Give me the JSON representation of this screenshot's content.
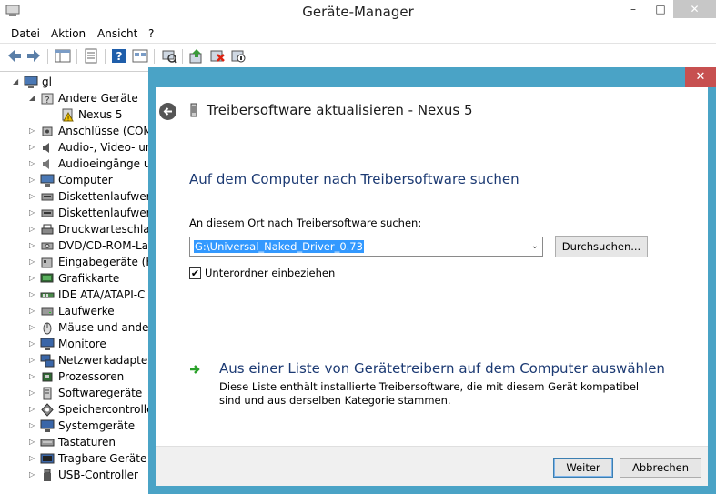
{
  "window": {
    "title": "Geräte-Manager",
    "controls": {
      "minimize": "–",
      "maximize": "□",
      "close": "✕"
    }
  },
  "menu": [
    "Datei",
    "Aktion",
    "Ansicht",
    "?"
  ],
  "toolbar_icons": [
    "back-icon",
    "forward-icon",
    "show-hide-tree-icon",
    "properties-icon",
    "help-icon",
    "view-icon",
    "scan-hardware-icon",
    "update-driver-icon",
    "uninstall-icon",
    "disable-device-icon"
  ],
  "tree": {
    "root": "gl",
    "items": [
      {
        "label": "Andere Geräte",
        "icon": "unknown-device-icon",
        "expanded": true
      },
      {
        "label": "Nexus 5",
        "icon": "warning-device-icon",
        "child": true
      },
      {
        "label": "Anschlüsse (COM",
        "icon": "port-icon"
      },
      {
        "label": "Audio-, Video- un",
        "icon": "audio-icon"
      },
      {
        "label": "Audioeingänge ur",
        "icon": "speaker-icon"
      },
      {
        "label": "Computer",
        "icon": "computer-icon"
      },
      {
        "label": "Diskettenlaufwerk",
        "icon": "floppy-drive-icon"
      },
      {
        "label": "Diskettenlaufwerk",
        "icon": "floppy-controller-icon"
      },
      {
        "label": "Druckwarteschlan",
        "icon": "printer-icon"
      },
      {
        "label": "DVD/CD-ROM-Lau",
        "icon": "dvd-icon"
      },
      {
        "label": "Eingabegeräte (Hu",
        "icon": "hid-icon"
      },
      {
        "label": "Grafikkarte",
        "icon": "display-adapter-icon"
      },
      {
        "label": "IDE ATA/ATAPI-C",
        "icon": "ide-icon"
      },
      {
        "label": "Laufwerke",
        "icon": "disk-icon"
      },
      {
        "label": "Mäuse und andere",
        "icon": "mouse-icon"
      },
      {
        "label": "Monitore",
        "icon": "monitor-icon"
      },
      {
        "label": "Netzwerkadapter",
        "icon": "network-icon"
      },
      {
        "label": "Prozessoren",
        "icon": "processor-icon"
      },
      {
        "label": "Softwaregeräte",
        "icon": "software-device-icon"
      },
      {
        "label": "Speichercontroller",
        "icon": "storage-controller-icon"
      },
      {
        "label": "Systemgeräte",
        "icon": "system-device-icon"
      },
      {
        "label": "Tastaturen",
        "icon": "keyboard-icon"
      },
      {
        "label": "Tragbare Geräte",
        "icon": "portable-device-icon"
      },
      {
        "label": "USB-Controller",
        "icon": "usb-icon"
      }
    ]
  },
  "dialog": {
    "title": "Treibersoftware aktualisieren - Nexus 5",
    "close": "✕",
    "heading": "Auf dem Computer nach Treibersoftware suchen",
    "path_label": "An diesem Ort nach Treibersoftware suchen:",
    "path_value": "G:\\Universal_Naked_Driver_0.73",
    "browse_label": "Durchsuchen...",
    "include_subfolders_label": "Unterordner einbeziehen",
    "include_subfolders_checked": "✔",
    "list_option_title": "Aus einer Liste von Gerätetreibern auf dem Computer auswählen",
    "list_option_desc": "Diese Liste enthält installierte Treibersoftware, die mit diesem Gerät kompatibel sind und aus derselben Kategorie stammen.",
    "next_label": "Weiter",
    "cancel_label": "Abbrechen"
  },
  "colors": {
    "dialog_frame": "#4aa3c6",
    "dialog_close": "#c75050",
    "heading_blue": "#1c3a73",
    "selection": "#3399ff"
  }
}
